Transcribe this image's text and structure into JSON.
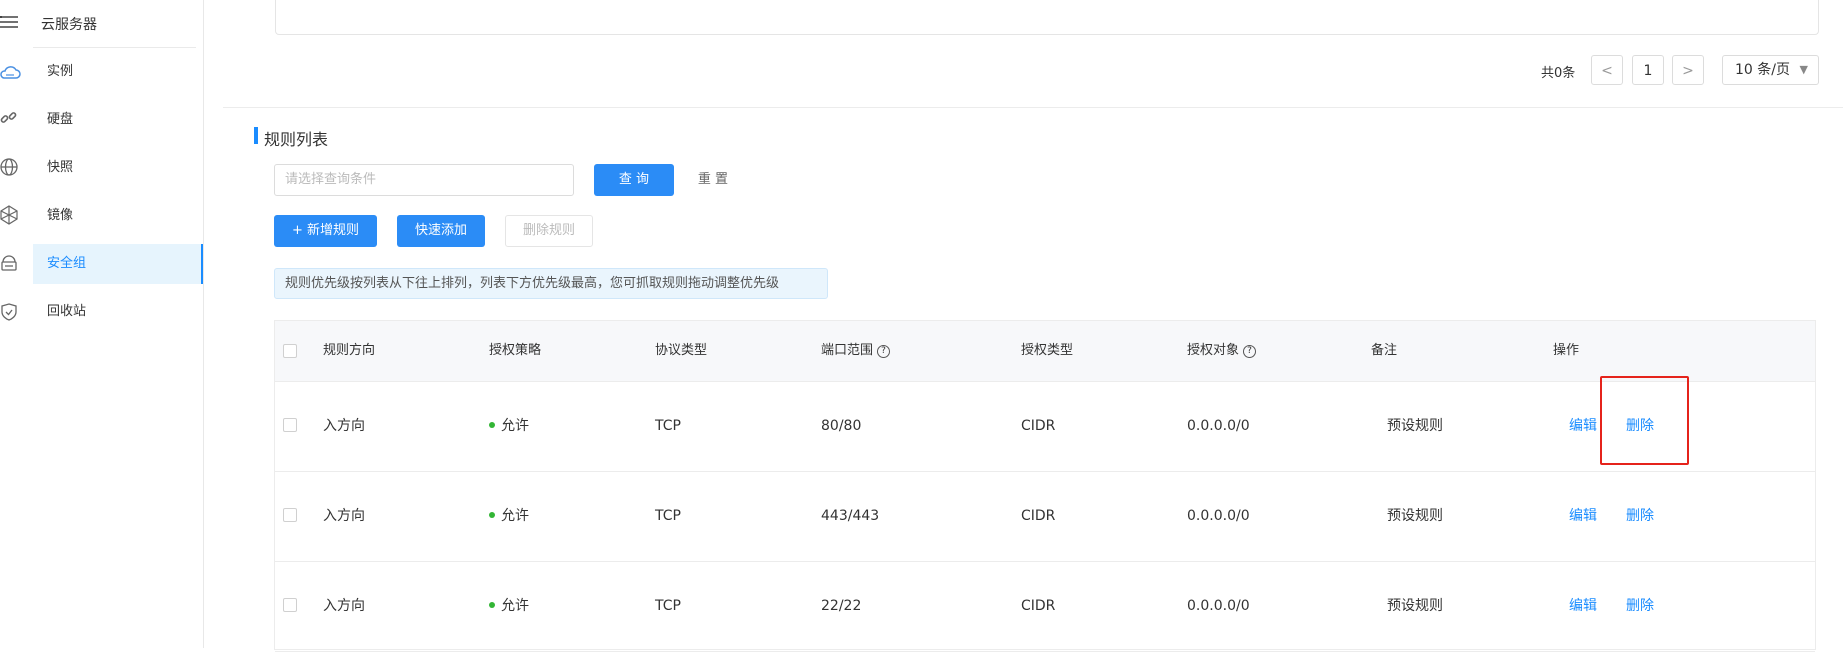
{
  "sidebar": {
    "title": "云服务器",
    "items": [
      {
        "label": "实例",
        "icon": "cloud-icon"
      },
      {
        "label": "硬盘",
        "icon": "link-icon"
      },
      {
        "label": "快照",
        "icon": "globe-icon"
      },
      {
        "label": "镜像",
        "icon": "network-icon"
      },
      {
        "label": "安全组",
        "icon": "cloud-server-icon",
        "active": true
      },
      {
        "label": "回收站",
        "icon": "shield-icon"
      }
    ]
  },
  "pager": {
    "total": "共0条",
    "prev": "<",
    "page": "1",
    "next": ">",
    "page_size": "10 条/页"
  },
  "rules_section": {
    "title": "规则列表",
    "search_placeholder": "请选择查询条件",
    "query_label": "查 询",
    "reset_label": "重 置",
    "add_label": "+ 新增规则",
    "quick_add_label": "快速添加",
    "delete_rules_label": "删除规则",
    "notice": "规则优先级按列表从下往上排列，列表下方优先级最高，您可抓取规则拖动调整优先级"
  },
  "table": {
    "headers": [
      "规则方向",
      "授权策略",
      "协议类型",
      "端口范围",
      "授权类型",
      "授权对象",
      "备注",
      "操作"
    ],
    "rows": [
      {
        "direction": "入方向",
        "policy": "允许",
        "protocol": "TCP",
        "port": "80/80",
        "auth_type": "CIDR",
        "target": "0.0.0.0/0",
        "remark": "预设规则",
        "edit": "编辑",
        "delete": "删除"
      },
      {
        "direction": "入方向",
        "policy": "允许",
        "protocol": "TCP",
        "port": "443/443",
        "auth_type": "CIDR",
        "target": "0.0.0.0/0",
        "remark": "预设规则",
        "edit": "编辑",
        "delete": "删除"
      },
      {
        "direction": "入方向",
        "policy": "允许",
        "protocol": "TCP",
        "port": "22/22",
        "auth_type": "CIDR",
        "target": "0.0.0.0/0",
        "remark": "预设规则",
        "edit": "编辑",
        "delete": "删除"
      }
    ]
  },
  "colors": {
    "accent": "#1a8cff",
    "highlight_box": "#e5231b",
    "allow_dot": "#32b535"
  }
}
